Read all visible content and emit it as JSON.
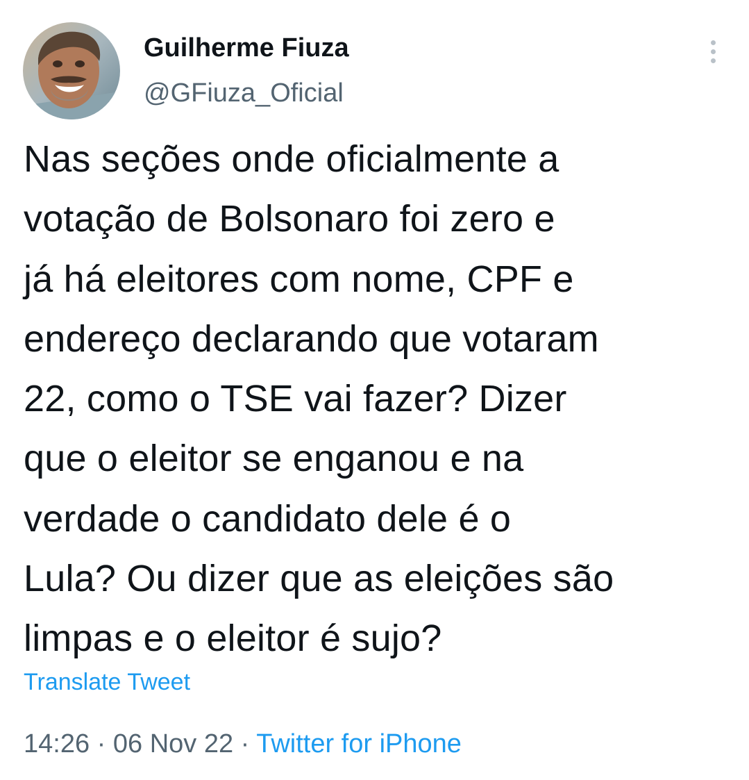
{
  "tweet": {
    "author": {
      "display_name": "Guilherme Fiuza",
      "handle": "@GFiuza_Oficial",
      "avatar": "profile-photo"
    },
    "more_icon": "more-vertical-icon",
    "text": "Nas seções onde oficialmente a\nvotação de Bolsonaro foi zero e\njá há eleitores com nome, CPF e\nendereço declarando que votaram\n22, como o TSE vai fazer? Dizer\nque o eleitor se enganou e na\nverdade o candidato dele é o\nLula? Ou dizer que as eleições são\nlimpas e o eleitor é sujo?",
    "translate_label": "Translate Tweet",
    "time": "14:26",
    "separator": "·",
    "date": "06 Nov 22",
    "source": "Twitter for iPhone"
  },
  "colors": {
    "text": "#0f1419",
    "secondary": "#536471",
    "link": "#1d9bf0",
    "background": "#ffffff"
  }
}
